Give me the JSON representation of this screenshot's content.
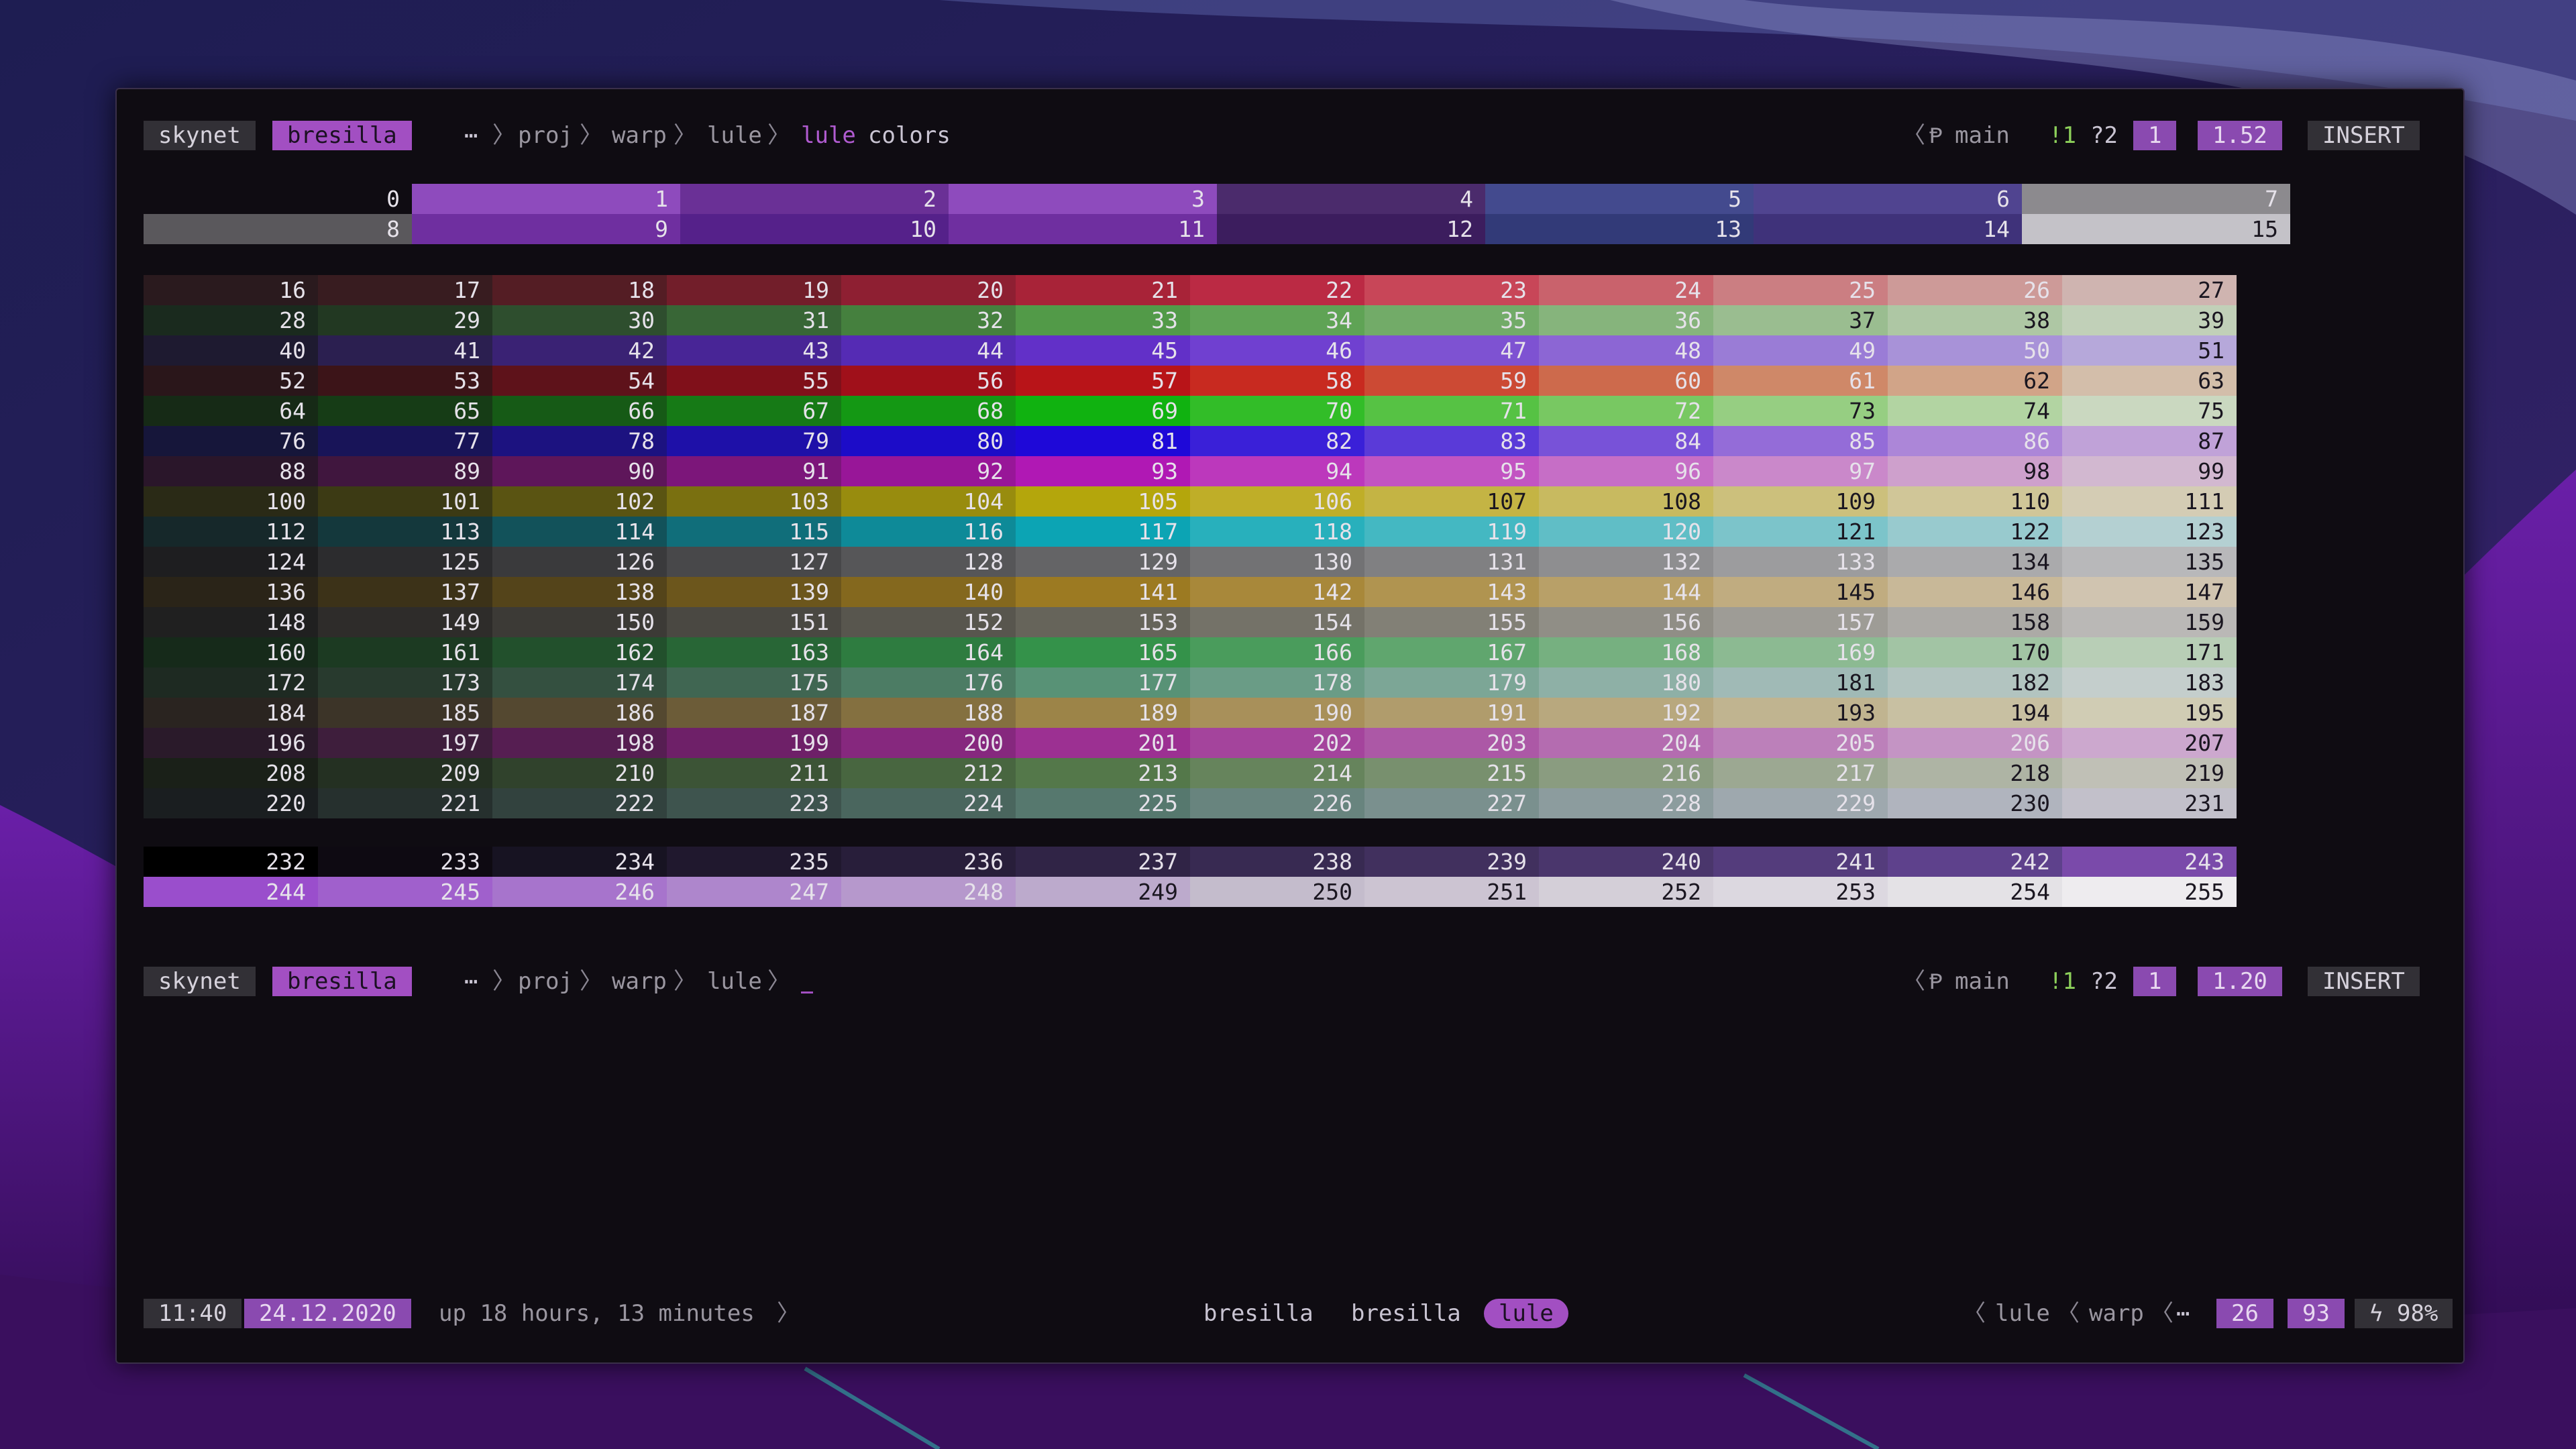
{
  "prompt": {
    "host": "skynet",
    "user": "bresilla",
    "ellipsis": "⋯",
    "path": [
      "proj",
      "warp",
      "lule"
    ],
    "command_name": "lule",
    "command_arg": "colors",
    "branch_icon": "Ᵽ",
    "branch": "main",
    "git_modified": "!1",
    "git_untracked": "?2",
    "jobs": "1",
    "time_first": "1.52",
    "time_second": "1.20",
    "mode": "INSERT"
  },
  "basic_colors": {
    "row1": [
      {
        "n": "0",
        "c": "#0f0c12"
      },
      {
        "n": "1",
        "c": "#8e4bbd"
      },
      {
        "n": "2",
        "c": "#6a3096"
      },
      {
        "n": "3",
        "c": "#8e4bbd"
      },
      {
        "n": "4",
        "c": "#4b2b6c"
      },
      {
        "n": "5",
        "c": "#434a8e"
      },
      {
        "n": "6",
        "c": "#504490"
      },
      {
        "n": "7",
        "c": "#8c8a8e"
      }
    ],
    "row2": [
      {
        "n": "8",
        "c": "#5a585c"
      },
      {
        "n": "9",
        "c": "#6f2fa0"
      },
      {
        "n": "10",
        "c": "#55218a"
      },
      {
        "n": "11",
        "c": "#6f2fa0"
      },
      {
        "n": "12",
        "c": "#3c1d5e"
      },
      {
        "n": "13",
        "c": "#323a78"
      },
      {
        "n": "14",
        "c": "#3f327a"
      },
      {
        "n": "15",
        "c": "#c4c2c8"
      }
    ]
  },
  "cube_rows": [
    [
      "#2a1a1e",
      "#381c20",
      "#541d24",
      "#721e2a",
      "#8e1f32",
      "#a82338",
      "#bb2a44",
      "#c84658",
      "#c9626c",
      "#cb7e82",
      "#cd9a98",
      "#cfb4b0"
    ],
    [
      "#1a2a1e",
      "#223822",
      "#2e4e2e",
      "#386636",
      "#45803e",
      "#529a48",
      "#5fa355",
      "#72ab68",
      "#86b47c",
      "#9abd90",
      "#aec7a4",
      "#c1d0b8"
    ],
    [
      "#1e1a30",
      "#2b1f50",
      "#3a2274",
      "#482596",
      "#552bb4",
      "#6230c8",
      "#7040d0",
      "#7e52d2",
      "#8c66d4",
      "#9a7cd6",
      "#a892d8",
      "#b6a8da"
    ],
    [
      "#2a161a",
      "#3c1418",
      "#5e121a",
      "#80101a",
      "#a0101a",
      "#b81418",
      "#c82a20",
      "#cc4a34",
      "#cd6a4c",
      "#cf8868",
      "#d1a488",
      "#d3beaa"
    ],
    [
      "#162a16",
      "#163c16",
      "#165a16",
      "#167a16",
      "#149814",
      "#10b210",
      "#32bd28",
      "#56c244",
      "#78c862",
      "#96ce82",
      "#b2d4a2",
      "#cad8c0"
    ],
    [
      "#16163a",
      "#181458",
      "#1c1280",
      "#1e10a8",
      "#1c0cc8",
      "#1e08d8",
      "#3a20d8",
      "#5a3ad8",
      "#7852d8",
      "#946cd8",
      "#ac86d8",
      "#c0a2d8"
    ],
    [
      "#2a162a",
      "#40163e",
      "#5e165a",
      "#7c167a",
      "#981698",
      "#b018b4",
      "#bc38bc",
      "#c254c2",
      "#c66ec6",
      "#ca88ca",
      "#cea0cc",
      "#d2b8d0"
    ],
    [
      "#2a2a16",
      "#3c3a14",
      "#5a5412",
      "#7a7010",
      "#988c0e",
      "#b4a60c",
      "#bfae28",
      "#c4b444",
      "#c8ba60",
      "#ccc07c",
      "#d0c698",
      "#d4ccb4"
    ],
    [
      "#16282a",
      "#14383c",
      "#12525a",
      "#106e7a",
      "#0e8a98",
      "#0ca4b4",
      "#28b0bc",
      "#44b8c2",
      "#60bec6",
      "#7cc4ca",
      "#98cace",
      "#b4d0d2"
    ],
    [
      "#1e1e20",
      "#2c2c2e",
      "#3a3a3c",
      "#48484a",
      "#565658",
      "#646466",
      "#727274",
      "#808082",
      "#8e8e90",
      "#9c9c9e",
      "#aaaaac",
      "#b8b8ba"
    ],
    [
      "#2a2418",
      "#3c3218",
      "#54441a",
      "#6c561c",
      "#84681e",
      "#9c7a22",
      "#a8883a",
      "#b09450",
      "#b8a068",
      "#c0ac80",
      "#c8b898",
      "#d0c4b0"
    ],
    [
      "#202020",
      "#2e2c2a",
      "#3c3a36",
      "#4a4842",
      "#58564e",
      "#66645a",
      "#747268",
      "#828076",
      "#908e86",
      "#9e9c96",
      "#acaaa6",
      "#bab8b6"
    ],
    [
      "#162a1a",
      "#1c3a22",
      "#22502c",
      "#286636",
      "#2e7c40",
      "#34924a",
      "#4a9c5c",
      "#60a66e",
      "#76b080",
      "#8cba92",
      "#a2c4a4",
      "#b8ceb6"
    ],
    [
      "#1e2a22",
      "#283a2e",
      "#345040",
      "#406652",
      "#4c7c64",
      "#589276",
      "#6a9c86",
      "#7ca696",
      "#8eb0a6",
      "#a0bab6",
      "#b2c4c0",
      "#c4cecc"
    ],
    [
      "#2a2420",
      "#3c3428",
      "#544830",
      "#6c5c38",
      "#847040",
      "#9c8448",
      "#a8905a",
      "#b09c6c",
      "#b8a87e",
      "#c0b490",
      "#c8c0a2",
      "#d0ccb4"
    ],
    [
      "#2a1a2a",
      "#3e1e3c",
      "#561e52",
      "#6e2068",
      "#86287e",
      "#9c3092",
      "#a4449c",
      "#ac58a6",
      "#b46cb0",
      "#bc80ba",
      "#c494c4",
      "#cca8ce"
    ],
    [
      "#1a2018",
      "#243022",
      "#30422c",
      "#3c5436",
      "#486640",
      "#54784a",
      "#66845c",
      "#78906e",
      "#8a9c80",
      "#9ca892",
      "#aeb4a4",
      "#c0c0b6"
    ],
    [
      "#1a1e20",
      "#26302e",
      "#32423e",
      "#3e544e",
      "#4a665e",
      "#56786e",
      "#68847e",
      "#7a908e",
      "#8c9c9e",
      "#9ea8ae",
      "#b0b4be",
      "#c2c0ca"
    ]
  ],
  "grays": {
    "row1": [
      "#000000",
      "#0e0a12",
      "#171322",
      "#20182e",
      "#281e3a",
      "#302446",
      "#382a52",
      "#41305e",
      "#4a366c",
      "#543c7c",
      "#5e418c",
      "#7a4aaa"
    ],
    "row2": [
      "#9a4ecc",
      "#a060cc",
      "#a774cc",
      "#ae86cc",
      "#b698cc",
      "#bcaacc",
      "#c4bccc",
      "#ccc4d2",
      "#d4cfd8",
      "#dcd8e0",
      "#e4e2e6",
      "#eeecef"
    ]
  },
  "status": {
    "time": "11:40",
    "date": "24.12.2020",
    "uptime": "up 18 hours, 13 minutes",
    "windows": [
      "bresilla",
      "bresilla",
      "lule"
    ],
    "right_path": [
      "lule",
      "warp",
      "⋯"
    ],
    "num1": "26",
    "num2": "93",
    "battery_icon": "ϟ",
    "battery": "98%"
  },
  "colors": {
    "purple": "#a24fc2",
    "terminal_bg": "#0f0c12",
    "pill_dark": "#323036"
  }
}
